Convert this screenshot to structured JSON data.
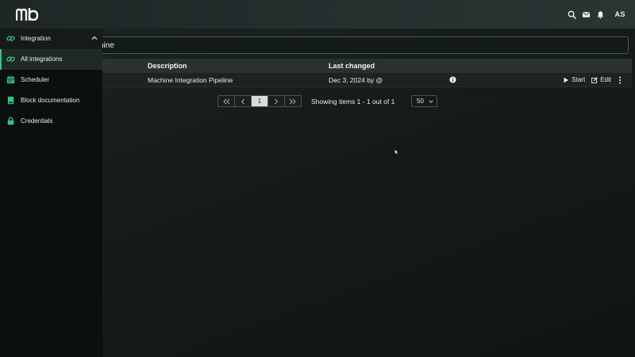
{
  "header": {
    "logo_icon": "mb-logo",
    "icons": [
      "search-icon",
      "mail-icon",
      "bell-icon"
    ],
    "user_initials": "AS"
  },
  "search": {
    "value": "hine"
  },
  "table": {
    "columns": [
      "Description",
      "Last changed"
    ],
    "rows": [
      {
        "description": "Machine Integration Pipeline",
        "last_changed": "Dec 3, 2024 by @",
        "actions": {
          "start": "Start",
          "edit": "Edit"
        }
      }
    ]
  },
  "pagination": {
    "current_page": "1",
    "info": "Showing items 1 - 1 out of 1",
    "per_page": "50"
  },
  "sidebar": {
    "group_label": "Integration",
    "items": [
      {
        "label": "All integrations",
        "icon": "link-icon",
        "active": true
      },
      {
        "label": "Scheduler",
        "icon": "calendar-icon",
        "active": false
      },
      {
        "label": "Block documentation",
        "icon": "book-icon",
        "active": false
      },
      {
        "label": "Credentials",
        "icon": "lock-icon",
        "active": false
      }
    ]
  },
  "colors": {
    "accent": "#36c27e",
    "sidebar_bg": "#0b0f0f",
    "topbar_bg": "#26302f"
  }
}
